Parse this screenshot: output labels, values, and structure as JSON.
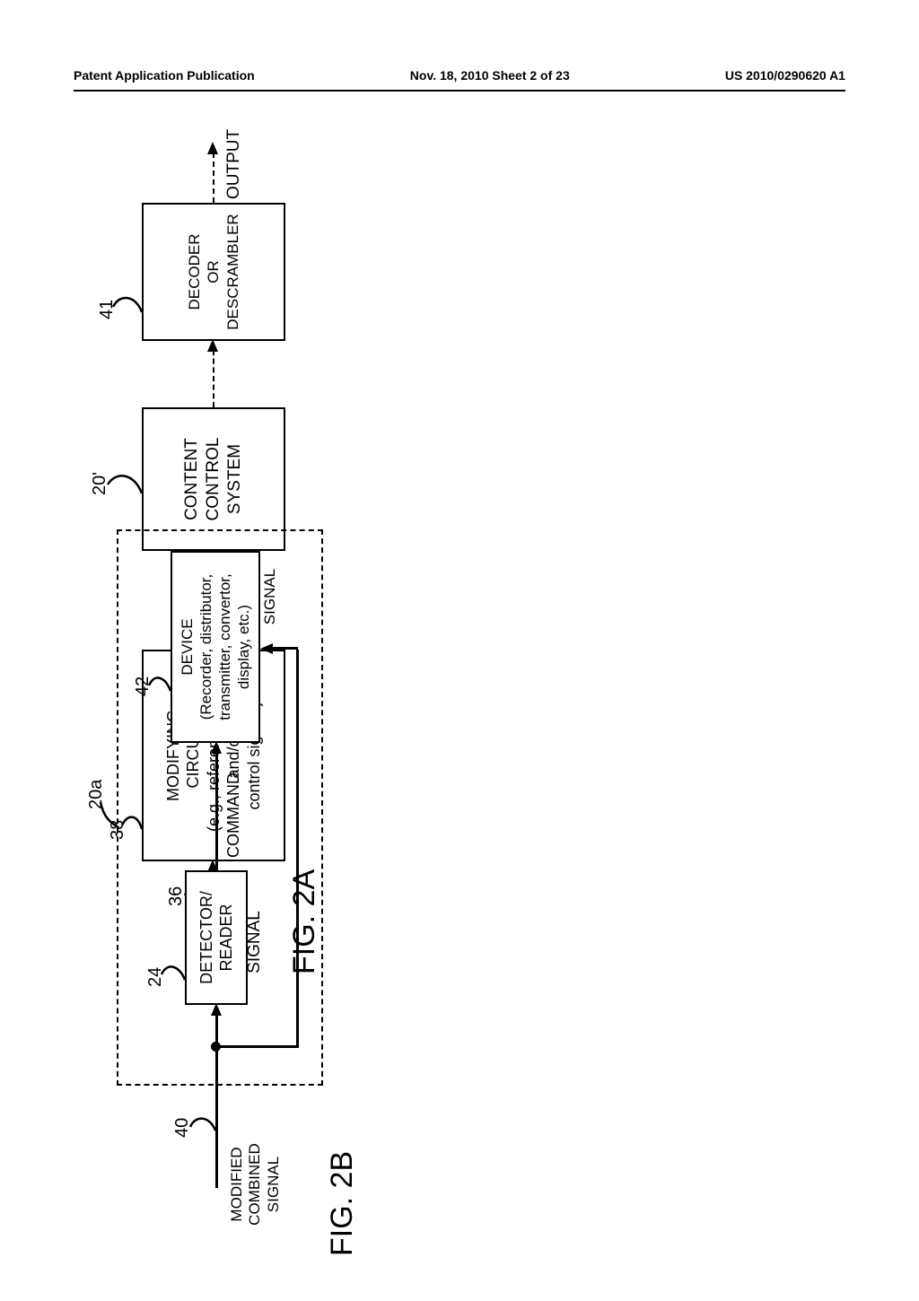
{
  "header": {
    "left": "Patent Application Publication",
    "center": "Nov. 18, 2010  Sheet 2 of 23",
    "right": "US 2010/0290620 A1"
  },
  "fig2a": {
    "caption": "FIG. 2A",
    "combined_signal": "COMBINED\nSIGNAL",
    "ref36": "36",
    "modifying": "MODIFYING\nCIRCUIT\n(e.g., reference, copy and/or\ncontrol signals)",
    "ref38": "38",
    "modified_combined": "MODIFIED\nCOMBINED\nSIGNAL",
    "ref40": "40",
    "content_control": "CONTENT\nCONTROL\nSYSTEM",
    "ref20p": "20'",
    "decoder": "DECODER\nOR\nDESCRAMBLER",
    "ref41": "41",
    "output": "OUTPUT"
  },
  "fig2b": {
    "caption": "FIG. 2B",
    "modified_combined": "MODIFIED\nCOMBINED\nSIGNAL",
    "ref40": "40",
    "detector": "DETECTOR/\nREADER",
    "ref24": "24",
    "command": "COMMAND",
    "device": "DEVICE\n(Recorder, distributor,\ntransmitter, convertor,\ndisplay, etc.)",
    "ref42": "42",
    "ref20a": "20a"
  }
}
